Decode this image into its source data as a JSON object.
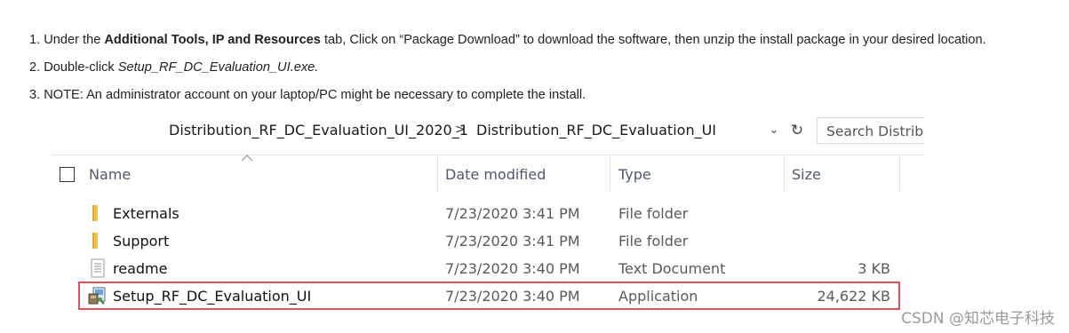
{
  "instructions": {
    "step1": {
      "prefix": "1. Under the ",
      "bold": "Additional Tools, IP and Resources",
      "suffix": " tab, Click on “Package Download” to download the software, then unzip the install package in your desired location."
    },
    "step2": {
      "prefix": "2. Double-click ",
      "italic": "Setup_RF_DC_Evaluation_UI.exe."
    },
    "step3": {
      "text": "3. NOTE: An administrator account on your laptop/PC might be necessary to complete the install."
    }
  },
  "explorer": {
    "breadcrumb": [
      "Distribution_RF_DC_Evaluation_UI_2020_1",
      "Distribution_RF_DC_Evaluation_UI"
    ],
    "breadcrumb_separator": ">",
    "dropdown_glyph": "⌄",
    "refresh_glyph": "↻",
    "search_placeholder": "Search Distribu",
    "columns": {
      "name": "Name",
      "date": "Date modified",
      "type": "Type",
      "size": "Size"
    },
    "files": [
      {
        "name": "Externals",
        "date": "7/23/2020 3:41 PM",
        "type": "File folder",
        "size": "",
        "icon": "folder-icon"
      },
      {
        "name": "Support",
        "date": "7/23/2020 3:41 PM",
        "type": "File folder",
        "size": "",
        "icon": "folder-icon"
      },
      {
        "name": "readme",
        "date": "7/23/2020 3:40 PM",
        "type": "Text Document",
        "size": "3 KB",
        "icon": "text-document-icon"
      },
      {
        "name": "Setup_RF_DC_Evaluation_UI",
        "date": "7/23/2020 3:40 PM",
        "type": "Application",
        "size": "24,622 KB",
        "icon": "setup-installer-icon"
      }
    ],
    "highlight_color": "#e25151",
    "folder_color": "#f2c14e"
  },
  "watermark": "CSDN @知芯电子科技"
}
